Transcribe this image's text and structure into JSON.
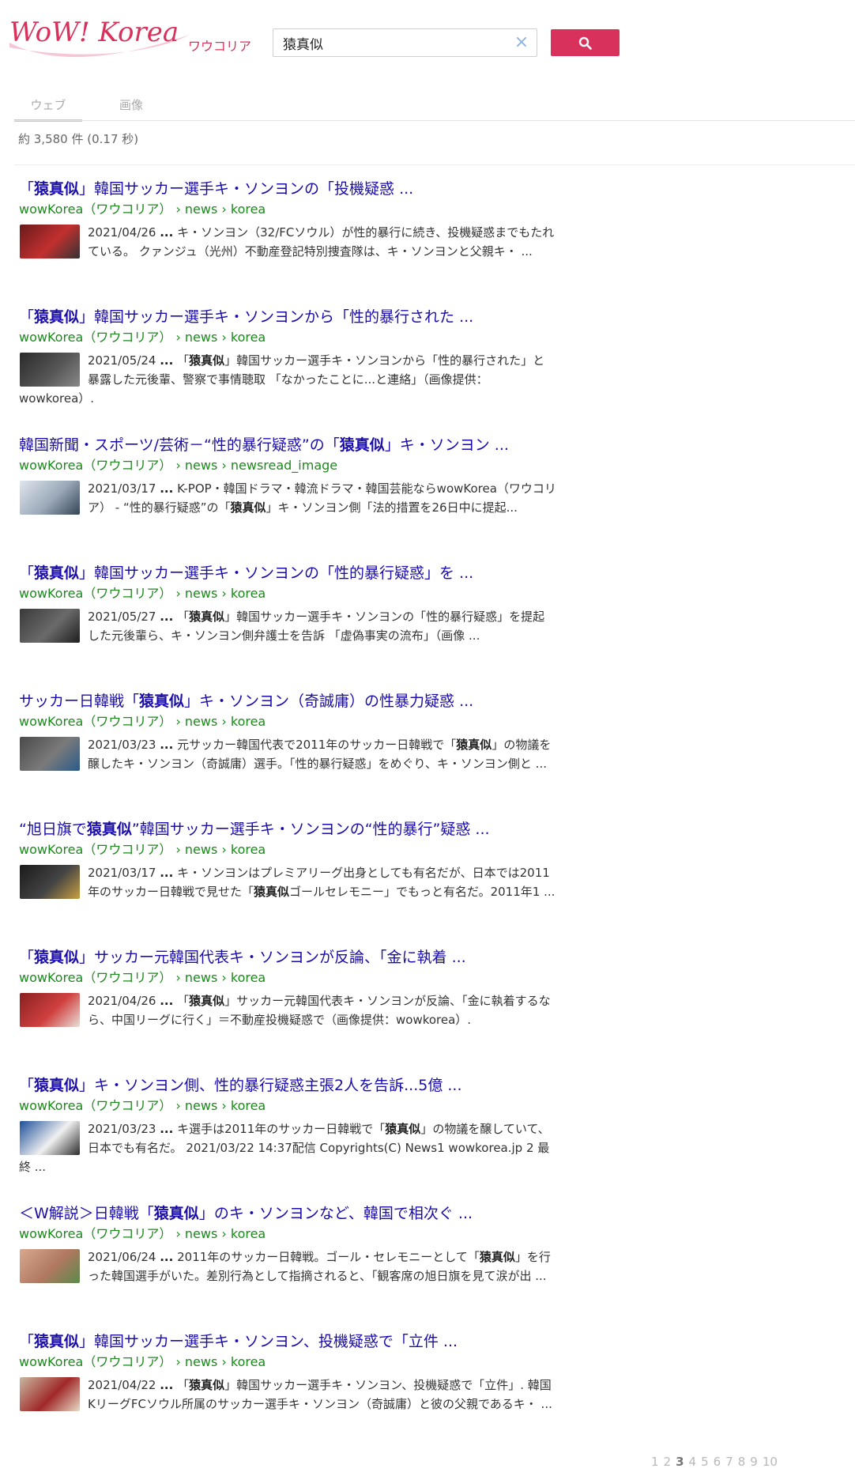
{
  "header": {
    "logo_text": "WoW! Korea",
    "logo_kana": "ワウコリア",
    "search_value": "猿真似",
    "clear_icon": "close-icon",
    "search_button_icon": "search-icon",
    "brand_color": "#d8315b"
  },
  "tabs": [
    {
      "label": "ウェブ",
      "active": true
    },
    {
      "label": "画像",
      "active": false
    }
  ],
  "stats": "約 3,580 件 (0.17 秒)",
  "results": [
    {
      "title_html": "「<b>猿真似</b>」韓国サッカー選手キ・ソンヨンの「投機疑惑 ...",
      "url": "wowKorea（ワウコリア） › news › korea",
      "snippet_html": "2021/04/26 <b>...</b> キ・ソンヨン（32/FCソウル）が性的暴行に続き、投機疑惑までもたれている。 クァンジュ（光州）不動産登記特別捜査隊は、キ・ソンヨンと父親キ・ ...",
      "thumb": [
        "#6b1a1a",
        "#c23030",
        "#333333"
      ]
    },
    {
      "title_html": "「<b>猿真似</b>」韓国サッカー選手キ・ソンヨンから「性的暴行された ...",
      "url": "wowKorea（ワウコリア） › news › korea",
      "snippet_html": "2021/05/24 <b>...</b> 「<b>猿真似</b>」韓国サッカー選手キ・ソンヨンから「性的暴行された」と暴露した元後輩、警察で事情聴取 「なかったことに...と連絡」（画像提供：wowkorea）.",
      "thumb": [
        "#2a2a2a",
        "#555555",
        "#888888"
      ]
    },
    {
      "title_html": "韓国新聞・スポーツ/芸術－“性的暴行疑惑”の「<b>猿真似</b>」キ・ソンヨン ...",
      "url": "wowKorea（ワウコリア） › news › newsread_image",
      "snippet_html": "2021/03/17 <b>...</b> K-POP・韓国ドラマ・韓流ドラマ・韓国芸能ならwowKorea（ワウコリア） - “性的暴行疑惑”の「<b>猿真似</b>」キ・ソンヨン側「法的措置を26日中に提起...",
      "thumb": [
        "#dfe6ee",
        "#9aa8b8",
        "#334455"
      ]
    },
    {
      "title_html": "「<b>猿真似</b>」韓国サッカー選手キ・ソンヨンの「性的暴行疑惑」を ...",
      "url": "wowKorea（ワウコリア） › news › korea",
      "snippet_html": "2021/05/27 <b>...</b> 「<b>猿真似</b>」韓国サッカー選手キ・ソンヨンの「性的暴行疑惑」を提起した元後輩ら、キ・ソンヨン側弁護士を告訴 「虚偽事実の流布」（画像 ...",
      "thumb": [
        "#3a3a3a",
        "#6a6a6a",
        "#1e1e1e"
      ]
    },
    {
      "title_html": "サッカー日韓戦「<b>猿真似</b>」キ・ソンヨン（奇誠庸）の性暴力疑惑 ...",
      "url": "wowKorea（ワウコリア） › news › korea",
      "snippet_html": "2021/03/23 <b>...</b> 元サッカー韓国代表で2011年のサッカー日韓戦で「<b>猿真似</b>」の物議を醸したキ・ソンヨン（奇誠庸）選手。「性的暴行疑惑」をめぐり、キ・ソンヨン側と ...",
      "thumb": [
        "#4a4a4a",
        "#7a7a7a",
        "#2a5a8a"
      ]
    },
    {
      "title_html": "“旭日旗で<b>猿真似</b>”韓国サッカー選手キ・ソンヨンの“性的暴行”疑惑 ...",
      "url": "wowKorea（ワウコリア） › news › korea",
      "snippet_html": "2021/03/17 <b>...</b> キ・ソンヨンはプレミアリーグ出身としても有名だが、日本では2011年のサッカー日韓戦で見せた「<b>猿真似</b>ゴールセレモニー」でもっと有名だ。2011年1 ...",
      "thumb": [
        "#1a1a1a",
        "#444444",
        "#c8a040"
      ]
    },
    {
      "title_html": "「<b>猿真似</b>」サッカー元韓国代表キ・ソンヨンが反論、「金に執着 ...",
      "url": "wowKorea（ワウコリア） › news › korea",
      "snippet_html": "2021/04/26 <b>...</b> 「<b>猿真似</b>」サッカー元韓国代表キ・ソンヨンが反論、「金に執着するなら、中国リーグに行く」＝不動産投機疑惑で（画像提供：wowkorea）.",
      "thumb": [
        "#8a2020",
        "#d04040",
        "#e8e0d8"
      ]
    },
    {
      "title_html": "「<b>猿真似</b>」キ・ソンヨン側、性的暴行疑惑主張2人を告訴...5億 ...",
      "url": "wowKorea（ワウコリア） › news › korea",
      "snippet_html": "2021/03/23 <b>...</b> キ選手は2011年のサッカー日韓戦で「<b>猿真似</b>」の物議を醸していて、日本でも有名だ。 2021/03/22 14:37配信 Copyrights(C) News1 wowkorea.jp 2 最終 ...",
      "thumb": [
        "#1d4f9a",
        "#f0f0f0",
        "#2b2b2b"
      ]
    },
    {
      "title_html": "＜W解説＞日韓戦「<b>猿真似</b>」のキ・ソンヨンなど、韓国で相次ぐ ...",
      "url": "wowKorea（ワウコリア） › news › korea",
      "snippet_html": "2021/06/24 <b>...</b> 2011年のサッカー日韓戦。ゴール・セレモニーとして「<b>猿真似</b>」を行った韓国選手がいた。差別行為として指摘されると、「観客席の旭日旗を見て涙が出 ...",
      "thumb": [
        "#d8a890",
        "#b07860",
        "#5a8a4a"
      ]
    },
    {
      "title_html": "「<b>猿真似</b>」韓国サッカー選手キ・ソンヨン、投機疑惑で「立件 ...",
      "url": "wowKorea（ワウコリア） › news › korea",
      "snippet_html": "2021/04/22 <b>...</b> 「<b>猿真似</b>」韓国サッカー選手キ・ソンヨン、投機疑惑で「立件」. 韓国KリーグFCソウル所属のサッカー選手キ・ソンヨン（奇誠庸）と彼の父親であるキ・ ...",
      "thumb": [
        "#c8b8a0",
        "#a02828",
        "#e8dcc8"
      ]
    }
  ],
  "pager": [
    "1",
    "2",
    "3",
    "4",
    "5",
    "6",
    "7",
    "8",
    "9",
    "10"
  ],
  "pager_current": 3
}
